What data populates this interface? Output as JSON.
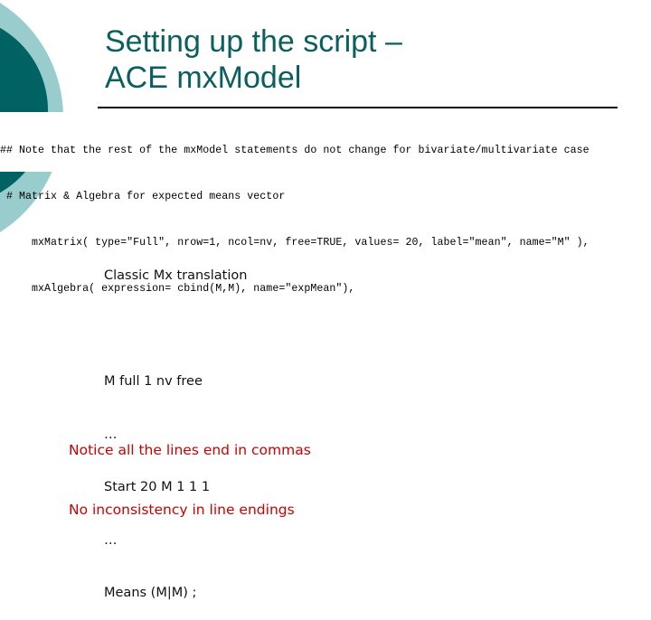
{
  "slide": {
    "title_lines": [
      "Setting up the script –",
      "ACE mxModel"
    ],
    "colors": {
      "title": "#0b5f5e",
      "dark_circle": "#006262",
      "light_circle": "#99cccc",
      "notice": "#cc0000"
    }
  },
  "code": {
    "lines": [
      "## Note that the rest of the mxModel statements do not change for bivariate/multivariate case",
      " # Matrix & Algebra for expected means vector",
      "     mxMatrix( type=\"Full\", nrow=1, ncol=nv, free=TRUE, values= 20, label=\"mean\", name=\"M\" ),",
      "     mxAlgebra( expression= cbind(M,M), name=\"expMean\"),"
    ]
  },
  "classic": {
    "heading": "Classic Mx translation",
    "lines": [
      "M full 1 nv free",
      "…",
      "Start 20 M 1 1 1",
      "…",
      "Means (M|M) ;"
    ]
  },
  "notice": {
    "lines": [
      "Notice all the lines end in commas",
      "No inconsistency in line endings"
    ]
  }
}
